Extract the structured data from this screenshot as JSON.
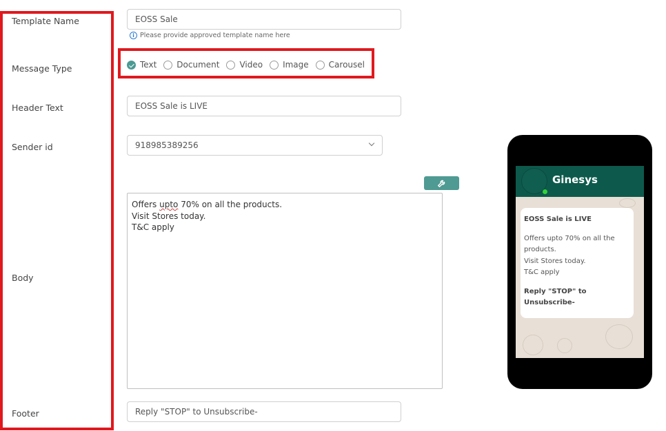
{
  "labels": {
    "template_name": "Template Name",
    "message_type": "Message Type",
    "header_text": "Header Text",
    "sender_id": "Sender id",
    "body": "Body",
    "footer": "Footer"
  },
  "template_name": {
    "value": "EOSS Sale",
    "hint": "Please provide approved template name here"
  },
  "message_type": {
    "options": [
      "Text",
      "Document",
      "Video",
      "Image",
      "Carousel"
    ],
    "selected": "Text"
  },
  "header_text": {
    "value": "EOSS Sale is LIVE"
  },
  "sender_id": {
    "value": "918985389256"
  },
  "body": {
    "line1_pre": "Offers ",
    "line1_misspelled": "upto",
    "line1_post": " 70% on all the products.",
    "line2": "Visit Stores today.",
    "line3": "T&C apply"
  },
  "footer": {
    "value": "Reply \"STOP\" to Unsubscribe-"
  },
  "preview": {
    "contact_name": "Ginesys",
    "header": "EOSS Sale is LIVE",
    "body_lines": [
      "Offers upto 70% on all the",
      "products.",
      "Visit Stores today.",
      "T&C apply"
    ],
    "footer_lines": [
      "Reply \"STOP\" to",
      "Unsubscribe-"
    ]
  },
  "colors": {
    "highlight": "#e0191e",
    "accent": "#4f9a93",
    "wa_header": "#0d5a4c",
    "online": "#33d13a"
  },
  "icons": {
    "info": "info-icon",
    "wrench": "wrench-icon",
    "chevron": "chevron-down-icon"
  }
}
